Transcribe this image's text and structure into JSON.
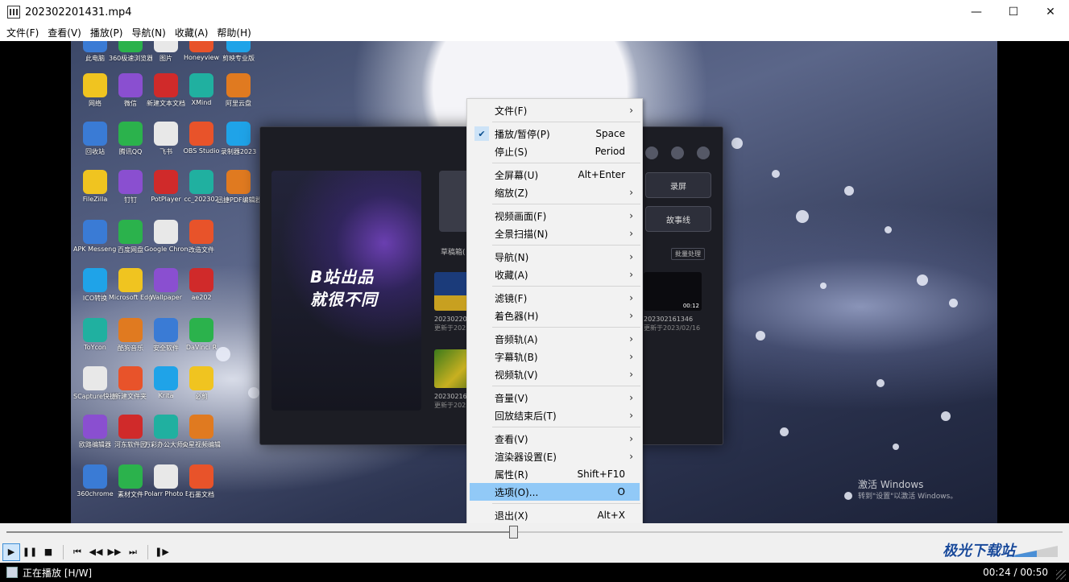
{
  "window": {
    "title": "202302201431.mp4",
    "minimize_glyph": "—",
    "maximize_glyph": "☐",
    "close_glyph": "✕"
  },
  "menubar": [
    "文件(F)",
    "查看(V)",
    "播放(P)",
    "导航(N)",
    "收藏(A)",
    "帮助(H)"
  ],
  "desktop_icons": [
    "此电脑",
    "360极速浏览器",
    "图片",
    "Honeyview",
    "剪映专业版",
    "网络",
    "微信",
    "新建文本文档",
    "XMind",
    "阿里云盘",
    "回收站",
    "腾讯QQ",
    "飞书",
    "OBS Studio",
    "录制器2023",
    "FileZilla",
    "钉钉",
    "PotPlayer",
    "cc_202302",
    "迅捷PDF编辑器",
    "APK Messenger",
    "百度网盘",
    "Google Chrome",
    "改造文件",
    "ICO转换",
    "Microsoft Edge",
    "Wallpaper",
    "ae202",
    "ToYcon",
    "酷狗音乐",
    "安全软件",
    "DaVinci R",
    "SCapture快捷方式",
    "新建文件夹",
    "Krita",
    "必剪",
    "欧路编辑器",
    "河东软件园",
    "万彩办公大师OfficeBox",
    "火星视频编辑",
    "360chrome",
    "素材文件",
    "Polarr Photo E",
    "石墨文档"
  ],
  "editor_app": {
    "banner_line1": "B站出品",
    "banner_line2": "就很不同",
    "drafts_label": "草稿箱(",
    "record_button": "录屏",
    "story_button": "故事线",
    "batch_button": "批量处理",
    "items": [
      {
        "name": "20230220143",
        "date": "更新于2023/0"
      },
      {
        "name": "202302161346",
        "date": "更新于2023/02/16",
        "duration": "00:12"
      },
      {
        "name": "20230216134",
        "date": "更新于2023/0"
      }
    ]
  },
  "activation_watermark": {
    "title": "激活 Windows",
    "subtitle": "转到\"设置\"以激活 Windows。"
  },
  "context_menu": {
    "groups": [
      [
        {
          "label": "文件(F)",
          "submenu": true
        }
      ],
      [
        {
          "label": "播放/暂停(P)",
          "shortcut": "Space",
          "checked": true
        },
        {
          "label": "停止(S)",
          "shortcut": "Period"
        }
      ],
      [
        {
          "label": "全屏幕(U)",
          "shortcut": "Alt+Enter"
        },
        {
          "label": "缩放(Z)",
          "submenu": true
        }
      ],
      [
        {
          "label": "视频画面(F)",
          "submenu": true
        },
        {
          "label": "全景扫描(N)",
          "submenu": true
        }
      ],
      [
        {
          "label": "导航(N)",
          "submenu": true
        },
        {
          "label": "收藏(A)",
          "submenu": true
        }
      ],
      [
        {
          "label": "滤镜(F)",
          "submenu": true
        },
        {
          "label": "着色器(H)",
          "submenu": true
        }
      ],
      [
        {
          "label": "音频轨(A)",
          "submenu": true
        },
        {
          "label": "字幕轨(B)",
          "submenu": true
        },
        {
          "label": "视频轨(V)",
          "submenu": true
        }
      ],
      [
        {
          "label": "音量(V)",
          "submenu": true
        },
        {
          "label": "回放结束后(T)",
          "submenu": true
        }
      ],
      [
        {
          "label": "查看(V)",
          "submenu": true
        },
        {
          "label": "渲染器设置(E)",
          "submenu": true
        },
        {
          "label": "属性(R)",
          "shortcut": "Shift+F10"
        },
        {
          "label": "选项(O)...",
          "shortcut": "O",
          "highlighted": true
        }
      ],
      [
        {
          "label": "退出(X)",
          "shortcut": "Alt+X"
        }
      ]
    ],
    "submenu_arrow": "›",
    "check_glyph": "✔"
  },
  "seek": {
    "progress": 0.48
  },
  "controls": {
    "buttons": [
      "play-icon",
      "pause-icon",
      "stop-icon",
      "skip-start-icon",
      "rewind-icon",
      "forward-icon",
      "skip-end-icon",
      "frame-step-icon"
    ],
    "glyphs": [
      "▶",
      "❚❚",
      "■",
      "⏮",
      "◀◀",
      "▶▶",
      "⏭",
      "❚▶"
    ],
    "volume_level": 0.6
  },
  "status": {
    "text": "正在播放 [H/W]",
    "time": "00:24 / 00:50"
  },
  "logo_watermark": "极光下载站"
}
